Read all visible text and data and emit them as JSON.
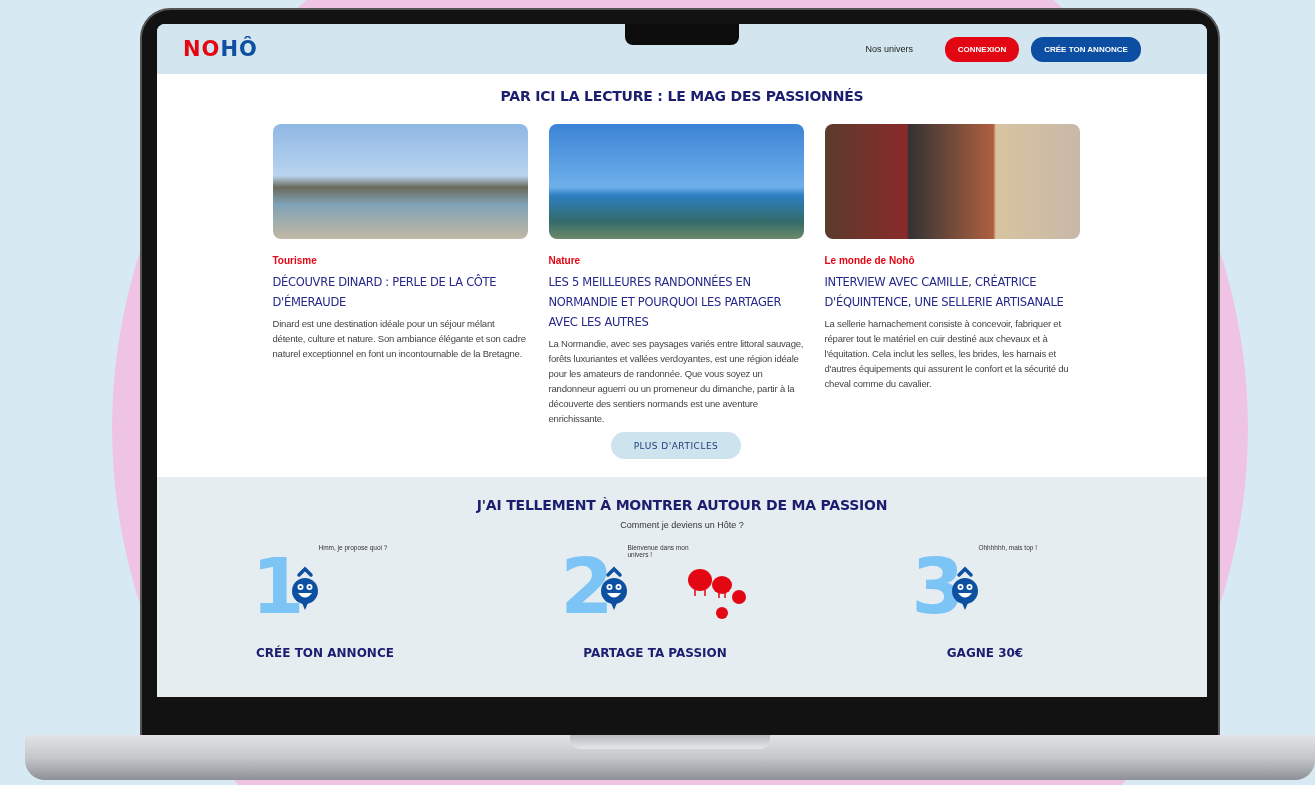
{
  "header": {
    "logo": [
      {
        "text": "N",
        "color": "#e30613"
      },
      {
        "text": "O",
        "color": "#e30613"
      },
      {
        "text": "HÔ",
        "color": "#0d4fa0"
      }
    ],
    "nav_link": "Nos univers",
    "buttons": [
      {
        "label": "CONNEXION",
        "kind": "login"
      },
      {
        "label": "CRÉE TON ANNONCE",
        "kind": "primary"
      }
    ]
  },
  "magazine": {
    "title": "PAR ICI LA LECTURE : LE MAG DES PASSIONNÉS",
    "articles": [
      {
        "category": "Tourisme",
        "title": "DÉCOUVRE DINARD : PERLE DE LA CÔTE D'ÉMERAUDE",
        "excerpt": "Dinard est une destination idéale pour un séjour mélant détente, culture et nature. Son ambiance élégante et son cadre naturel exceptionnel en font un incontournable de la Bretagne."
      },
      {
        "category": "Nature",
        "title": "LES 5 MEILLEURES RANDONNÉES EN NORMANDIE ET POURQUOI LES PARTAGER AVEC LES AUTRES",
        "excerpt": "La Normandie, avec ses paysages variés entre littoral sauvage, forêts luxuriantes et vallées verdoyantes, est une région idéale pour les amateurs de randonnée. Que vous soyez un randonneur aguerri ou un promeneur du dimanche, partir à la découverte des sentiers normands est une aventure enrichissante."
      },
      {
        "category": "Le monde de Nohô",
        "title": "INTERVIEW AVEC CAMILLE, CRÉATRICE D'ÉQUINTENCE, UNE SELLERIE ARTISANALE",
        "excerpt": "La sellerie harnachement consiste à concevoir, fabriquer et réparer tout le matériel en cuir destiné aux chevaux et à l'équitation. Cela inclut les selles, les brides, les harnais et d'autres équipements qui assurent le confort et la sécurité du cheval comme du cavalier."
      }
    ],
    "more_button": "PLUS D'ARTICLES"
  },
  "host": {
    "title": "J'AI TELLEMENT À MONTRER AUTOUR DE MA PASSION",
    "subtitle": "Comment je deviens un Hôte ?",
    "steps": [
      {
        "number": "1",
        "speech": "Hmm, je propose quoi ?",
        "kind": "solo",
        "label": "CRÉE TON ANNONCE"
      },
      {
        "number": "2",
        "speech": "Bienvenue dans mon univers !",
        "kind": "group",
        "label": "PARTAGE TA PASSION"
      },
      {
        "number": "3",
        "speech": "Ohhhhhh, mais top !",
        "kind": "solo",
        "label": "GAGNE 30€"
      }
    ]
  }
}
